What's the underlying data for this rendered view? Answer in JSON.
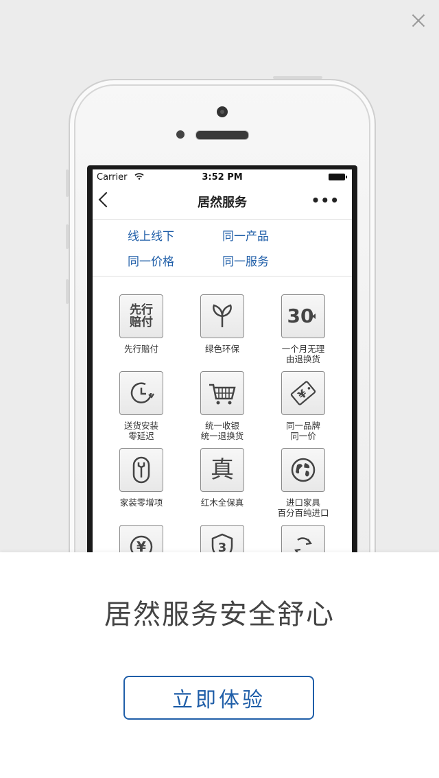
{
  "status_bar": {
    "carrier": "Carrier",
    "time": "3:52 PM"
  },
  "nav": {
    "title": "居然服务",
    "more": "•••"
  },
  "slogans": [
    "线上线下",
    "同一产品",
    "同一价格",
    "同一服务"
  ],
  "services": [
    {
      "icon": "xianxing-peifu-icon",
      "icon_text": "先行\n赔付",
      "label": "先行赔付"
    },
    {
      "icon": "sprout-icon",
      "icon_text": "",
      "label": "绿色环保"
    },
    {
      "icon": "thirty-days-icon",
      "icon_text": "30",
      "label": "一个月无理\n由退换货"
    },
    {
      "icon": "clock-icon",
      "icon_text": "",
      "label": "送货安装\n零延迟"
    },
    {
      "icon": "cart-icon",
      "icon_text": "",
      "label": "统一收银\n统一退换货"
    },
    {
      "icon": "price-tag-icon",
      "icon_text": "",
      "label": "同一品牌\n同一价"
    },
    {
      "icon": "wrench-icon",
      "icon_text": "",
      "label": "家装零增项"
    },
    {
      "icon": "zhen-icon",
      "icon_text": "真",
      "label": "红木全保真"
    },
    {
      "icon": "globe-icon",
      "icon_text": "",
      "label": "进口家具\n百分百纯进口"
    },
    {
      "icon": "yen-icon",
      "icon_text": "",
      "label": ""
    },
    {
      "icon": "shield-3-icon",
      "icon_text": "3",
      "label": ""
    },
    {
      "icon": "recycle-icon",
      "icon_text": "",
      "label": ""
    }
  ],
  "headline": "居然服务安全舒心",
  "cta_label": "立即体验",
  "colors": {
    "accent": "#1f5ea8",
    "background": "#ececec"
  }
}
